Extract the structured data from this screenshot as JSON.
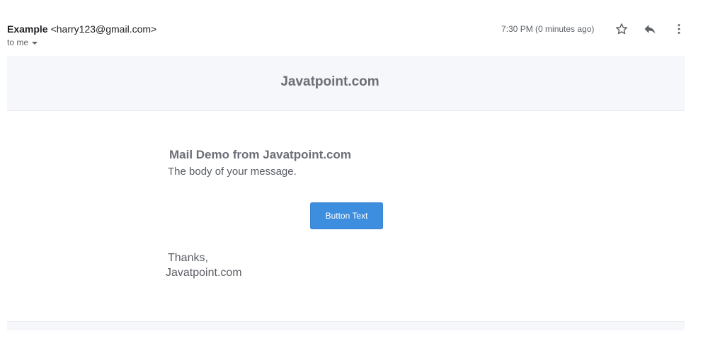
{
  "header": {
    "sender_name": "Example",
    "sender_email": "<harry123@gmail.com>",
    "recipient": "to me",
    "timestamp": "7:30 PM (0 minutes ago)",
    "icons": [
      "star-icon",
      "reply-icon",
      "more-vert-icon"
    ]
  },
  "email": {
    "banner_title": "Javatpoint.com",
    "heading": "Mail Demo from Javatpoint.com",
    "body": "The body of your message.",
    "button_label": "Button Text",
    "signoff": "Thanks,",
    "signature": "Javatpoint.com"
  },
  "colors": {
    "button": "#3d8ede",
    "banner_bg": "#f6f7fb",
    "muted_text": "#6b6e76"
  }
}
